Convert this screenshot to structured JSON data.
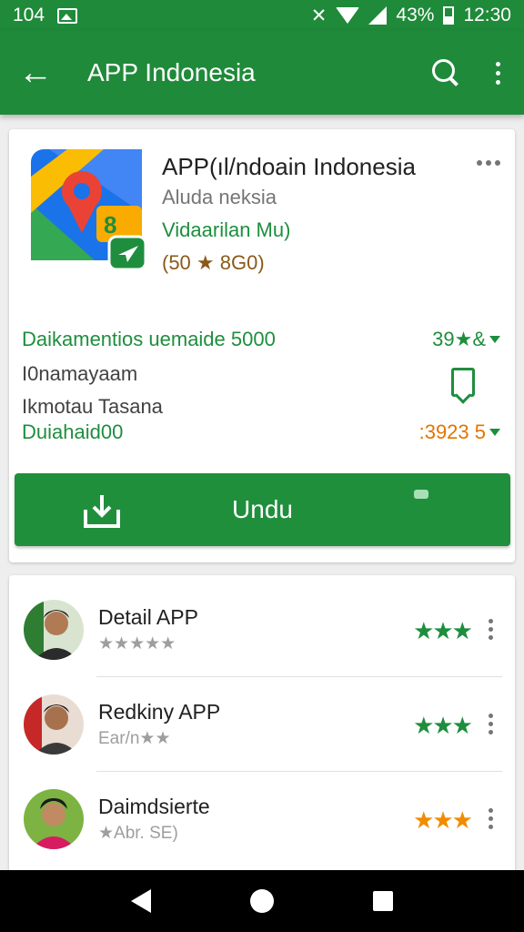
{
  "status_bar": {
    "time_left": "104",
    "battery_percent": "43%",
    "clock": "12:30"
  },
  "toolbar": {
    "title": "APP Indonesia"
  },
  "app": {
    "name": "APP(ıl/ndoain Indonesia",
    "developer": "Aluda neksia",
    "category": "Vidaarilan Mu)",
    "rating_line": "(50 ★ 8G0)"
  },
  "info": {
    "row1_label": "Daikamentios uemaide 5000",
    "row1_value": "39★&",
    "row2_label": "I0namayaam",
    "row3_label": "Ikmotau Tasana",
    "row4_label": "Duiahaid00",
    "row4_value": ":3923 5"
  },
  "install": {
    "label": "Undu"
  },
  "reviews": [
    {
      "title": "Detail APP",
      "subtitle": "★★★★★",
      "stars": "★★★",
      "star_color": "#1e8e3e"
    },
    {
      "title": "Redkiny APP",
      "subtitle": "Ear/n★★",
      "stars": "★★★",
      "star_color": "#1e8e3e"
    },
    {
      "title": "Daimdsierte",
      "subtitle": "★Abr. SE)",
      "stars": "★★★",
      "star_color": "#f08c00"
    }
  ],
  "colors": {
    "primary": "#1f8a3a",
    "accent_green": "#1e8e3e",
    "accent_orange": "#e37400"
  }
}
